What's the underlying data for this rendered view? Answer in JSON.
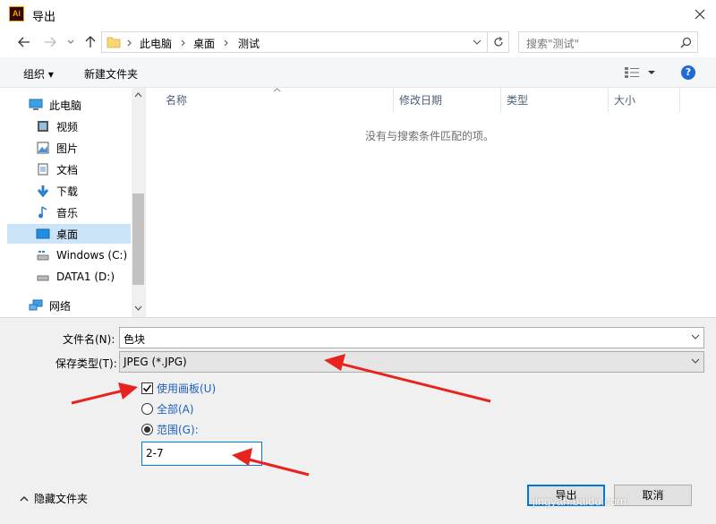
{
  "window": {
    "title": "导出",
    "app_icon_text": "Ai"
  },
  "breadcrumb": [
    "此电脑",
    "桌面",
    "测试"
  ],
  "search": {
    "placeholder": "搜索\"测试\""
  },
  "toolbar": {
    "organize_label": "组织 ▾",
    "new_folder_label": "新建文件夹",
    "help_label": "?"
  },
  "sidebar": {
    "items": [
      {
        "label": "此电脑",
        "icon": "computer-icon"
      },
      {
        "label": "视频",
        "icon": "video-icon"
      },
      {
        "label": "图片",
        "icon": "pictures-icon"
      },
      {
        "label": "文档",
        "icon": "documents-icon"
      },
      {
        "label": "下载",
        "icon": "download-icon"
      },
      {
        "label": "音乐",
        "icon": "music-icon"
      },
      {
        "label": "桌面",
        "icon": "desktop-icon",
        "selected": true
      },
      {
        "label": "Windows (C:)",
        "icon": "drive-icon"
      },
      {
        "label": "DATA1 (D:)",
        "icon": "drive-icon"
      },
      {
        "label": "网络",
        "icon": "network-icon"
      }
    ]
  },
  "file_list": {
    "columns": [
      "名称",
      "修改日期",
      "类型",
      "大小"
    ],
    "empty_message": "没有与搜索条件匹配的项。"
  },
  "form": {
    "filename_label": "文件名(N):",
    "filename_value": "色块",
    "filetype_label": "保存类型(T):",
    "filetype_value": "JPEG (*.JPG)",
    "use_artboards_label": "使用画板(U)",
    "use_artboards_checked": true,
    "all_label": "全部(A)",
    "range_label": "范围(G):",
    "range_selected": true,
    "range_value": "2-7"
  },
  "footer": {
    "hide_folders_label": "隐藏文件夹",
    "export_label": "导出",
    "cancel_label": "取消",
    "watermark": "jingyan.baidu.com"
  },
  "colors": {
    "accent": "#0078d7",
    "link": "#1c5fbd",
    "annotation_arrow": "#e8231f"
  }
}
